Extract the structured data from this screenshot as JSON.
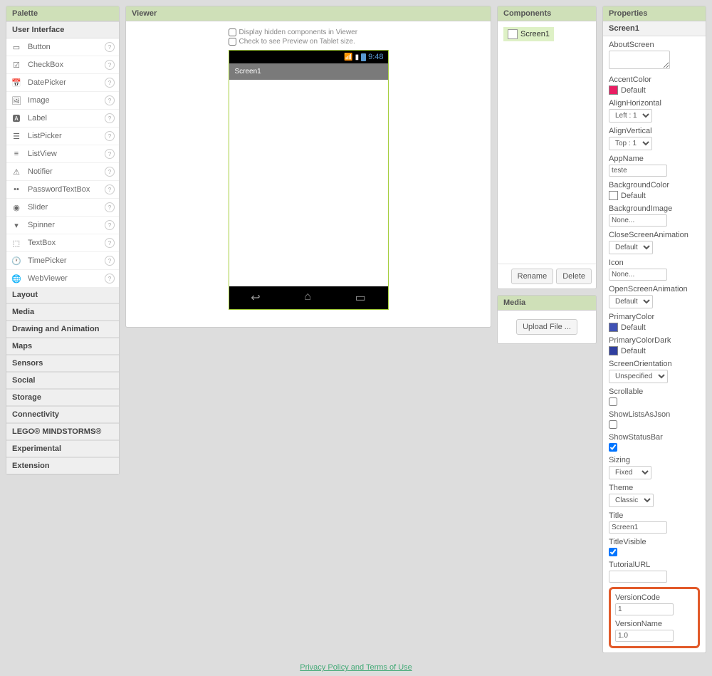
{
  "palette": {
    "title": "Palette",
    "userInterface": "User Interface",
    "items": [
      "Button",
      "CheckBox",
      "DatePicker",
      "Image",
      "Label",
      "ListPicker",
      "ListView",
      "Notifier",
      "PasswordTextBox",
      "Slider",
      "Spinner",
      "TextBox",
      "TimePicker",
      "WebViewer"
    ],
    "categories": [
      "Layout",
      "Media",
      "Drawing and Animation",
      "Maps",
      "Sensors",
      "Social",
      "Storage",
      "Connectivity",
      "LEGO® MINDSTORMS®",
      "Experimental",
      "Extension"
    ]
  },
  "viewer": {
    "title": "Viewer",
    "showHidden": "Display hidden components in Viewer",
    "tabletPreview": "Check to see Preview on Tablet size.",
    "time": "9:48",
    "screenTitle": "Screen1"
  },
  "components": {
    "title": "Components",
    "root": "Screen1",
    "rename": "Rename",
    "delete": "Delete"
  },
  "media": {
    "title": "Media",
    "upload": "Upload File ..."
  },
  "properties": {
    "title": "Properties",
    "subject": "Screen1",
    "aboutScreen": {
      "label": "AboutScreen",
      "value": ""
    },
    "accentColor": {
      "label": "AccentColor",
      "value": "Default"
    },
    "alignHorizontal": {
      "label": "AlignHorizontal",
      "value": "Left : 1"
    },
    "alignVertical": {
      "label": "AlignVertical",
      "value": "Top : 1"
    },
    "appName": {
      "label": "AppName",
      "value": "teste"
    },
    "backgroundColor": {
      "label": "BackgroundColor",
      "value": "Default"
    },
    "backgroundImage": {
      "label": "BackgroundImage",
      "value": "None..."
    },
    "closeScreenAnimation": {
      "label": "CloseScreenAnimation",
      "value": "Default"
    },
    "icon": {
      "label": "Icon",
      "value": "None..."
    },
    "openScreenAnimation": {
      "label": "OpenScreenAnimation",
      "value": "Default"
    },
    "primaryColor": {
      "label": "PrimaryColor",
      "value": "Default"
    },
    "primaryColorDark": {
      "label": "PrimaryColorDark",
      "value": "Default"
    },
    "screenOrientation": {
      "label": "ScreenOrientation",
      "value": "Unspecified"
    },
    "scrollable": {
      "label": "Scrollable",
      "checked": false
    },
    "showListsAsJson": {
      "label": "ShowListsAsJson",
      "checked": false
    },
    "showStatusBar": {
      "label": "ShowStatusBar",
      "checked": true
    },
    "sizing": {
      "label": "Sizing",
      "value": "Fixed"
    },
    "theme": {
      "label": "Theme",
      "value": "Classic"
    },
    "titleProp": {
      "label": "Title",
      "value": "Screen1"
    },
    "titleVisible": {
      "label": "TitleVisible",
      "checked": true
    },
    "tutorialURL": {
      "label": "TutorialURL",
      "value": ""
    },
    "versionCode": {
      "label": "VersionCode",
      "value": "1"
    },
    "versionName": {
      "label": "VersionName",
      "value": "1.0"
    }
  },
  "footer": {
    "link": "Privacy Policy and Terms of Use"
  }
}
